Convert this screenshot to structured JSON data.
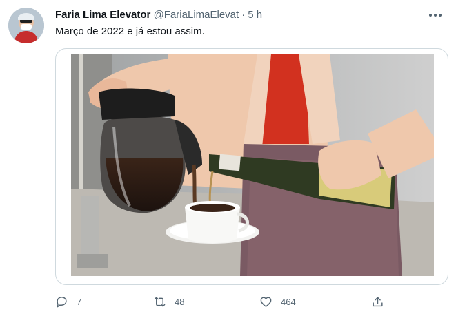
{
  "tweet": {
    "display_name": "Faria Lima Elevator",
    "handle": "@FariaLimaElevat",
    "separator": "·",
    "timestamp": "5 h",
    "text": "Março de 2022 e já estou assim."
  },
  "actions": {
    "reply_count": "7",
    "retweet_count": "48",
    "like_count": "464"
  },
  "icons": [
    "avatar",
    "more-icon",
    "reply-icon",
    "retweet-icon",
    "like-icon",
    "share-icon"
  ],
  "colors": {
    "text_primary": "#0f1419",
    "text_secondary": "#536471",
    "border": "#cfd9de"
  }
}
